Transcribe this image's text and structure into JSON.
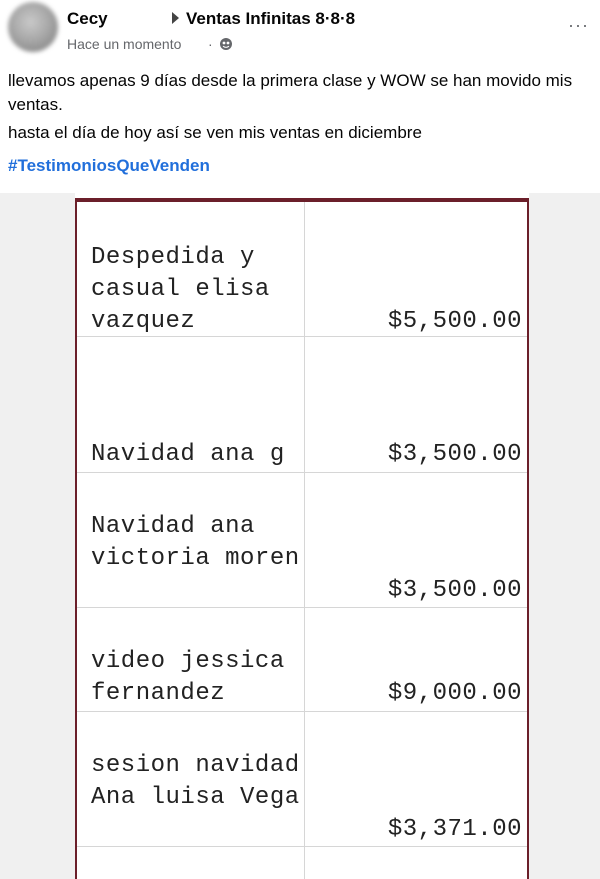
{
  "post": {
    "author": "Cecy",
    "group": "Ventas Infinitas 8·8·8",
    "timestamp": "Hace un momento",
    "separator": "·",
    "paragraph1": "llevamos apenas 9 días desde la primera clase y WOW se han movido mis ventas.",
    "paragraph2": "hasta el día de hoy así se ven mis ventas en diciembre",
    "hashtag": "#TestimoniosQueVenden",
    "more_label": "···"
  },
  "sales": {
    "rows": [
      {
        "description": "Despedida y casual elisa vazquez",
        "amount": "$5,500.00"
      },
      {
        "description": "Navidad ana g",
        "amount": "$3,500.00"
      },
      {
        "description": "Navidad ana victoria moren",
        "amount": "$3,500.00"
      },
      {
        "description": "video jessica fernandez",
        "amount": "$9,000.00"
      },
      {
        "description": "sesion navidad Ana luisa Vega",
        "amount": "$3,371.00"
      }
    ]
  },
  "colors": {
    "hashtag": "#216fdb",
    "secondary_text": "#65676b",
    "sheet_border": "#6b1f2a"
  },
  "icons": [
    "triangle-right-icon",
    "globe-icon",
    "more-options-icon"
  ]
}
